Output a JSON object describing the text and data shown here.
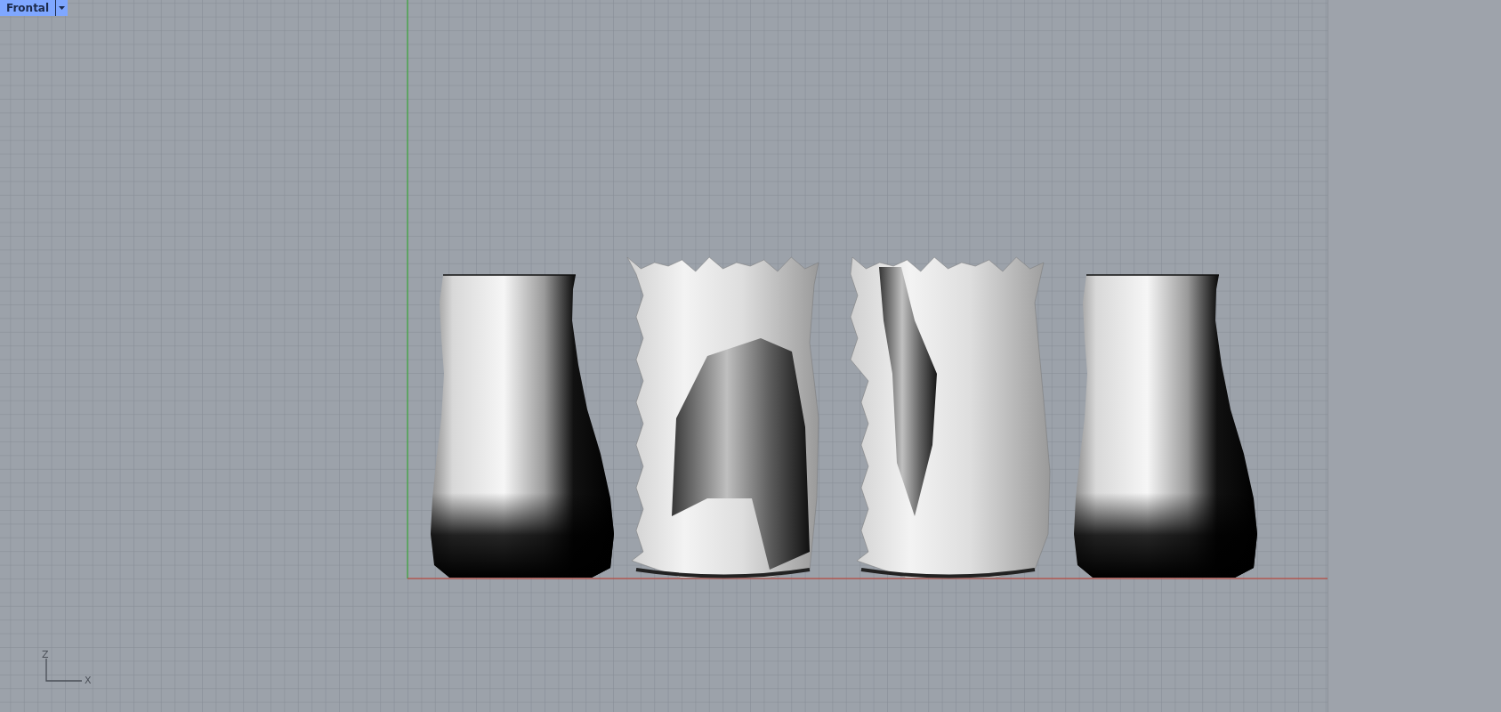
{
  "viewport": {
    "tab": {
      "label": "Frontal",
      "selected": true
    },
    "axis_icon": {
      "vertical_label": "Z",
      "horizontal_label": "X"
    },
    "objects": [
      {
        "kind": "smooth"
      },
      {
        "kind": "mesh"
      },
      {
        "kind": "mesh"
      },
      {
        "kind": "smooth"
      }
    ]
  }
}
